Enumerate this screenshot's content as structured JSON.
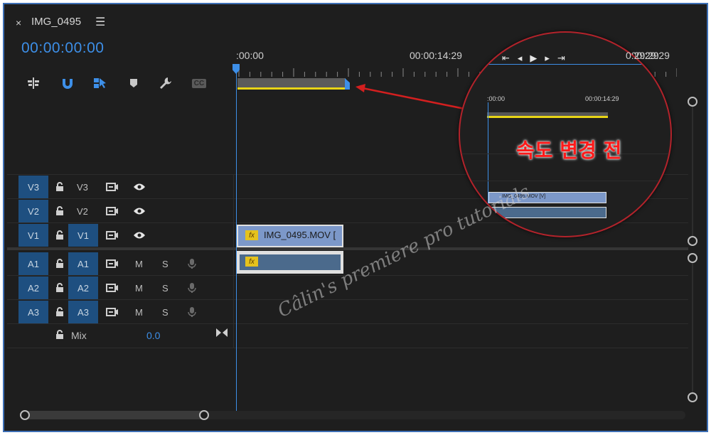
{
  "header": {
    "close_glyph": "×",
    "sequence_title": "IMG_0495",
    "menu_glyph": "☰",
    "timecode": "00:00:00:00"
  },
  "toolbar": {
    "icons": [
      "insert-nest-icon",
      "snap-magnet-icon",
      "linked-selection-icon",
      "add-marker-icon",
      "wrench-settings-icon",
      "captions-icon"
    ],
    "captions_label": "CC"
  },
  "ruler": {
    "labels": [
      ":00:00",
      "00:00:14:29",
      "00:00:29:29"
    ]
  },
  "tracks": {
    "video": [
      {
        "source": "V3",
        "target": "V3"
      },
      {
        "source": "V2",
        "target": "V2"
      },
      {
        "source": "V1",
        "target": "V1"
      }
    ],
    "audio": [
      {
        "source": "A1",
        "target": "A1",
        "mute": "M",
        "solo": "S"
      },
      {
        "source": "A2",
        "target": "A2",
        "mute": "M",
        "solo": "S"
      },
      {
        "source": "A3",
        "target": "A3",
        "mute": "M",
        "solo": "S"
      }
    ],
    "mix_label": "Mix",
    "mix_value": "0.0"
  },
  "clips": {
    "v1_name": "IMG_0495.MOV [",
    "fx": "fx"
  },
  "magnifier": {
    "ruler_start": ":00:00",
    "ruler_mid": "00:00:14:29",
    "ruler_end": "0:29:29",
    "clip_name": "IMG_0495.MOV [V]",
    "note": "속도 변경 전"
  },
  "watermark": "Câlin's premiere pro tutorials",
  "colors": {
    "accent": "#3d8fe8",
    "track_header": "#1e4f80",
    "video_clip": "#7c98c9",
    "audio_clip": "#4b6a8c",
    "work_area": "#e8d416",
    "callout": "#b3232b"
  }
}
